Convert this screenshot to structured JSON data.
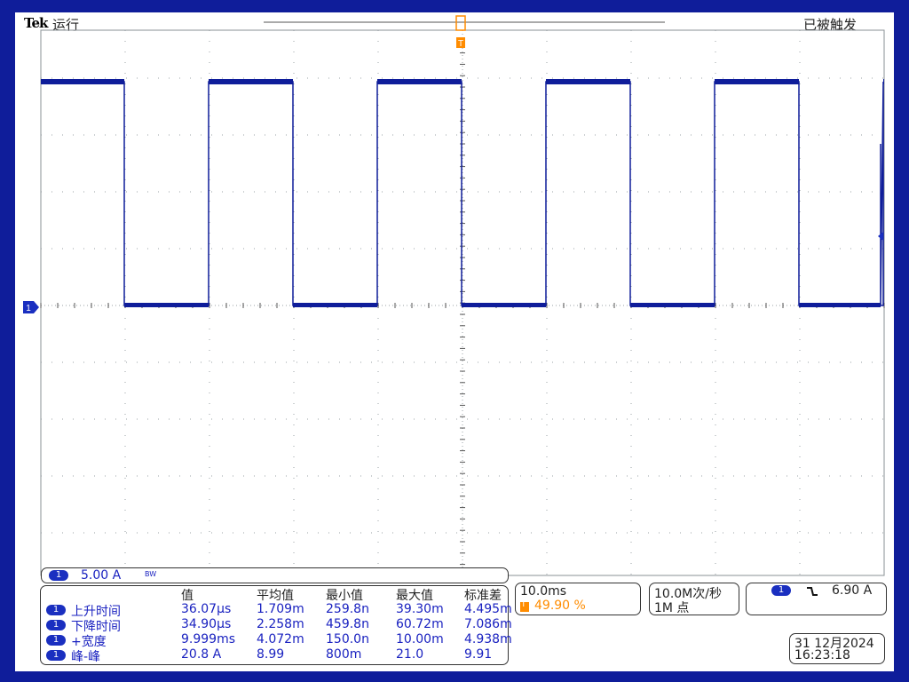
{
  "topbar": {
    "brand": "Tek",
    "state": "运行",
    "trigger_status": "已被触发"
  },
  "markers": {
    "trigger_marker": "T",
    "channel_marker": "1"
  },
  "channel": {
    "number": "1",
    "scale": "5.00 A",
    "bandwidth_glyph": "BW"
  },
  "measurements": {
    "headers": [
      "值",
      "平均值",
      "最小值",
      "最大值",
      "标准差"
    ],
    "rows": [
      {
        "ch": "1",
        "label": "上升时间",
        "values": [
          "36.07µs",
          "1.709m",
          "259.8n",
          "39.30m",
          "4.495m"
        ]
      },
      {
        "ch": "1",
        "label": "下降时间",
        "values": [
          "34.90µs",
          "2.258m",
          "459.8n",
          "60.72m",
          "7.086m"
        ]
      },
      {
        "ch": "1",
        "label": "+宽度",
        "values": [
          "9.999ms",
          "4.072m",
          "150.0n",
          "10.00m",
          "4.938m"
        ]
      },
      {
        "ch": "1",
        "label": "峰-峰",
        "values": [
          "20.8 A",
          "8.99",
          "800m",
          "21.0",
          "9.91"
        ]
      }
    ]
  },
  "horizontal": {
    "timebase": "10.0ms",
    "trigger_marker": "T",
    "trigger_position": "49.90 %"
  },
  "acquisition": {
    "sample_rate": "10.0M次/秒",
    "record_length": "1M 点"
  },
  "trigger": {
    "channel": "1",
    "slope_glyph": "falling-edge",
    "level": "6.90 A"
  },
  "datetime": {
    "date": "31 12月2024",
    "time": "16:23:18"
  },
  "waveform": {
    "type": "square wave",
    "period_ms": 20.0,
    "positive_width_ms": 10.0,
    "high_level_div": 4,
    "low_level_div": 0,
    "colors": {
      "trace": "#0f1d9a",
      "grid": "#9aa0a6",
      "trigger": "#ff8c00"
    }
  }
}
